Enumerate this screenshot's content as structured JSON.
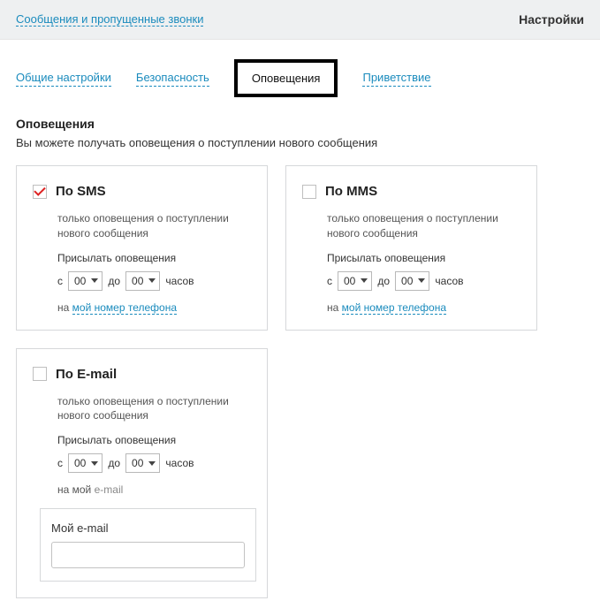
{
  "topbar": {
    "breadcrumb": "Сообщения и пропущенные звонки",
    "title": "Настройки"
  },
  "tabs": [
    {
      "label": "Общие настройки",
      "active": false
    },
    {
      "label": "Безопасность",
      "active": false
    },
    {
      "label": "Оповещения",
      "active": true
    },
    {
      "label": "Приветствие",
      "active": false
    }
  ],
  "section": {
    "title": "Оповещения",
    "desc": "Вы можете получать оповещения о поступлении нового сообщения"
  },
  "labels": {
    "from": "с",
    "to": "до",
    "hours": "часов",
    "send": "Присылать оповещения",
    "on": "на",
    "on_my_email_prefix": "на мой",
    "on_my_email_suffix": "e-mail"
  },
  "cards": {
    "sms": {
      "title": "По SMS",
      "checked": true,
      "sub": "только оповещения о поступлении нового сообщения",
      "from": "00",
      "to": "00",
      "link": "мой номер телефона"
    },
    "mms": {
      "title": "По MMS",
      "checked": false,
      "sub": "только оповещения о поступлении нового сообщения",
      "from": "00",
      "to": "00",
      "link": "мой номер телефона"
    },
    "email": {
      "title": "По E-mail",
      "checked": false,
      "sub": "только оповещения о поступлении нового сообщения",
      "from": "00",
      "to": "00",
      "input_label": "Мой e-mail",
      "input_value": ""
    }
  }
}
